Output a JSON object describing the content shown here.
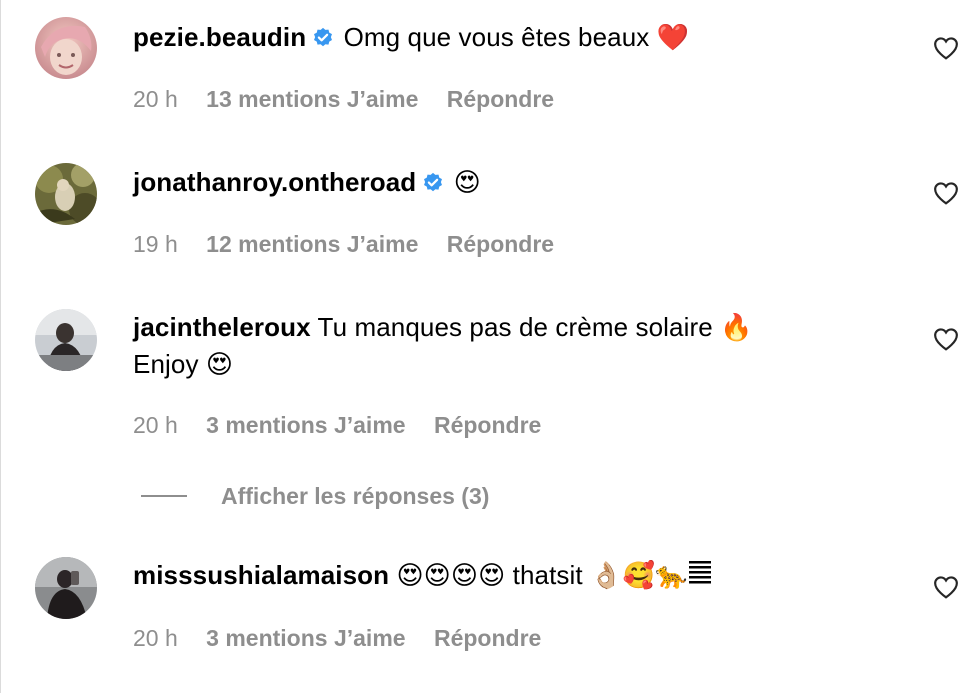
{
  "comments": [
    {
      "username": "pezie.beaudin",
      "verified": true,
      "text": "Omg que vous êtes beaux",
      "emoji": "❤️",
      "time": "20 h",
      "likes": "13 mentions J’aime",
      "reply": "Répondre"
    },
    {
      "username": "jonathanroy.ontheroad",
      "verified": true,
      "text": "",
      "emoji": "😍",
      "time": "19 h",
      "likes": "12 mentions J’aime",
      "reply": "Répondre"
    },
    {
      "username": "jacintheleroux",
      "verified": false,
      "text": "Tu manques pas de crème solaire",
      "emoji": "🔥",
      "text2": "Enjoy",
      "emoji2": "😍",
      "time": "20 h",
      "likes": "3 mentions J’aime",
      "reply": "Répondre"
    },
    {
      "username": "misssushialamaison",
      "verified": false,
      "emoji": "😍😍😍😍",
      "text": "thatsit",
      "emoji2": "👌🏼🥰🐆",
      "time": "20 h",
      "likes": "3 mentions J’aime",
      "reply": "Répondre"
    }
  ],
  "replies_toggle": {
    "label": "Afficher les réponses (3)"
  },
  "colors": {
    "verified": "#3897f0",
    "meta": "#8e8e8e",
    "heart_emoji": "#e0245e",
    "divider": "#dbdbdb"
  },
  "icons": {
    "like": "heart-outline-icon",
    "verified": "verified-badge-icon"
  }
}
